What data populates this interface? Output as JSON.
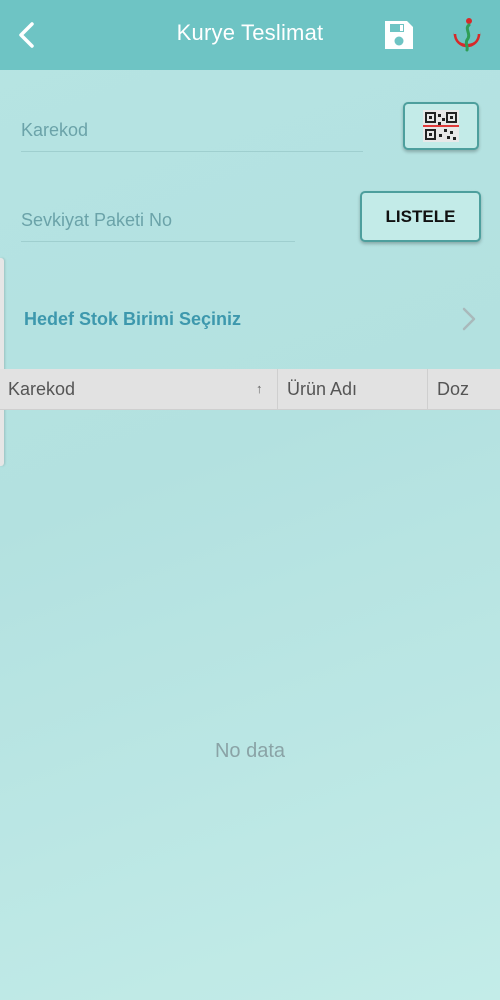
{
  "header": {
    "title": "Kurye Teslimat",
    "back_icon": "chevron-left-icon",
    "save_icon": "floppy-disk-icon",
    "logo_icon": "ministry-logo-icon"
  },
  "form": {
    "karekod_placeholder": "Karekod",
    "karekod_value": "",
    "sevkiyat_placeholder": "Sevkiyat Paketi No",
    "sevkiyat_value": "",
    "scan_button_icon": "qr-code-icon",
    "list_button_label": "LISTELE"
  },
  "target": {
    "label": "Hedef Stok Birimi Seçiniz",
    "icon": "chevron-right-icon"
  },
  "table": {
    "columns": [
      "Karekod",
      "Ürün Adı",
      "Doz"
    ],
    "sort_icon": "↑",
    "rows": [],
    "empty_text": "No data"
  },
  "colors": {
    "header": "#6ec4c4",
    "accent_text": "#3d98ad",
    "background": "#b6e4e3",
    "button_border": "#4d9f9d"
  }
}
